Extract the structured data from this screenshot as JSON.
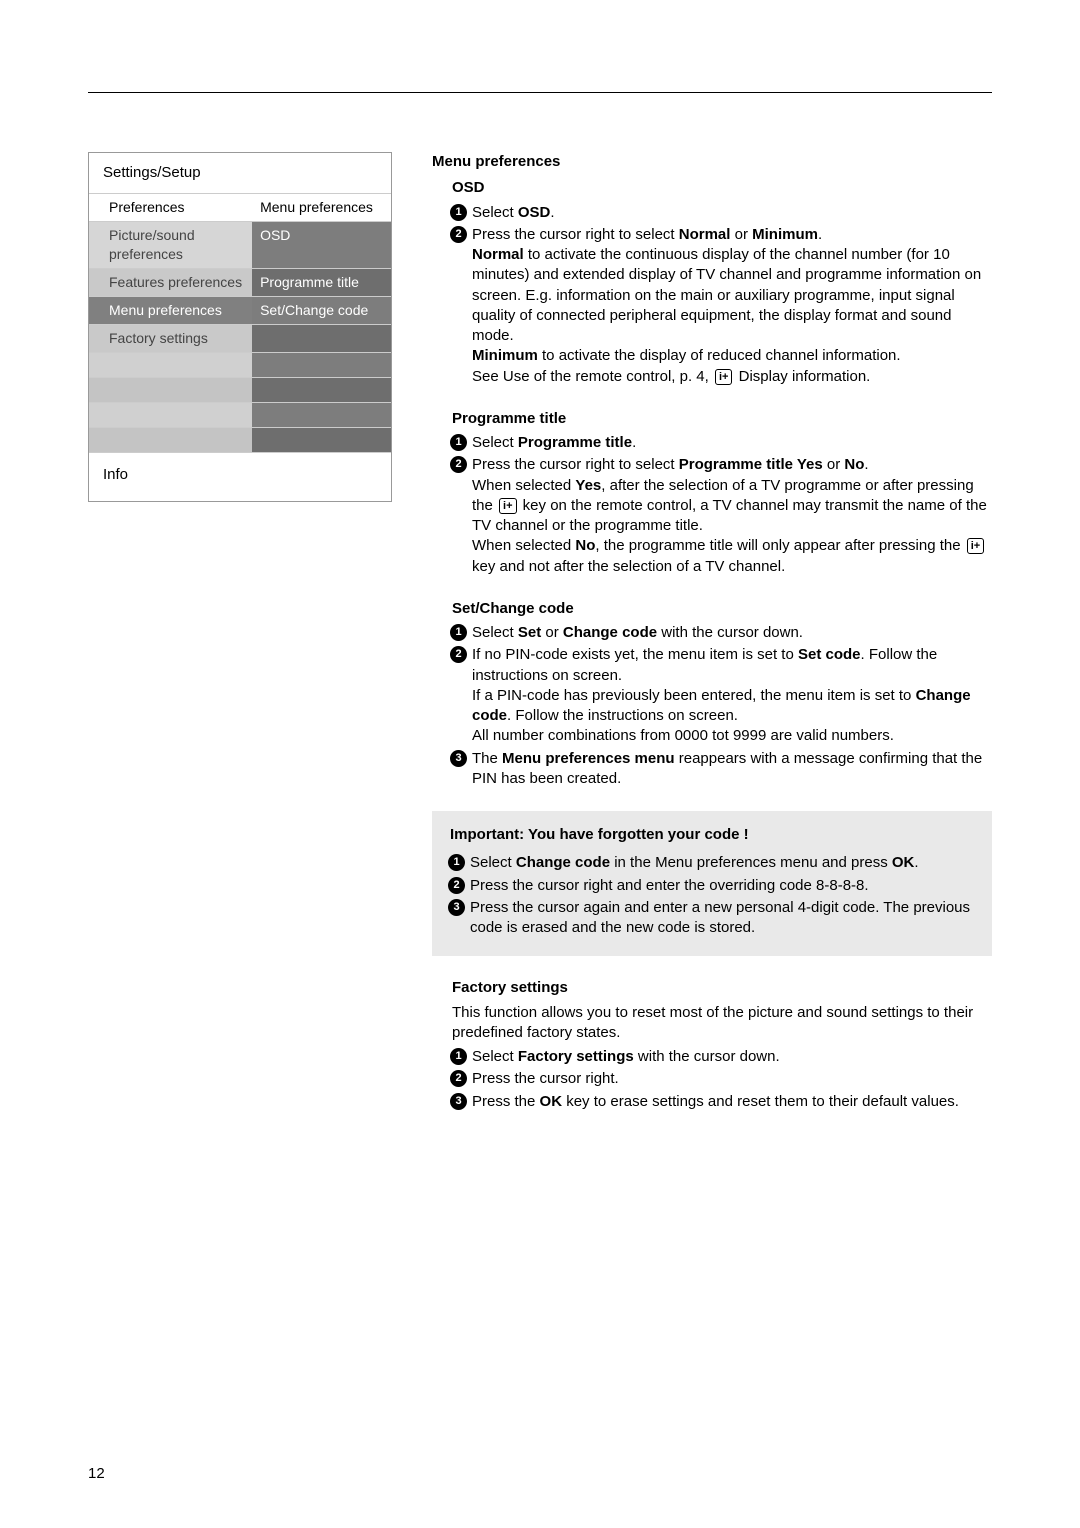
{
  "page_number": "12",
  "menu": {
    "box_title": "Settings/Setup",
    "col_left_header": "Preferences",
    "col_right_header": "Menu preferences",
    "rows": [
      {
        "l": "Picture/sound preferences",
        "r": "OSD"
      },
      {
        "l": "Features preferences",
        "r": "Programme title"
      },
      {
        "l": "Menu preferences",
        "r": "Set/Change code",
        "selected": true
      },
      {
        "l": "Factory settings",
        "r": ""
      }
    ],
    "footer": "Info"
  },
  "right": {
    "title": "Menu preferences",
    "osd": {
      "heading": "OSD",
      "step1_pre": "Select ",
      "step1_bold": "OSD",
      "step1_post": ".",
      "step2_pre": "Press the cursor right to select ",
      "step2_b1": "Normal",
      "step2_mid": " or ",
      "step2_b2": "Minimum",
      "step2_post": ".",
      "para1_b": "Normal",
      "para1": " to activate the continuous display of the channel number (for 10 minutes) and extended display of TV channel and programme information on screen. E.g. information on the main or auxiliary programme, input signal quality of connected peripheral equipment, the display format and sound mode.",
      "para2_b": "Minimum",
      "para2": " to activate the display of reduced channel information.",
      "para3_pre": "See Use of the remote control, p. 4, ",
      "para3_post": " Display information.",
      "info_icon": "i+"
    },
    "prog": {
      "heading": "Programme title",
      "step1_pre": "Select ",
      "step1_bold": "Programme title",
      "step1_post": ".",
      "step2_pre": "Press the cursor right to select ",
      "step2_bold": "Programme title Yes",
      "step2_mid": " or ",
      "step2_bold2": "No",
      "step2_post": ".",
      "para1_pre": "When selected ",
      "para1_b": "Yes",
      "para1_mid": ", after the selection of a TV programme or after pressing the ",
      "para1_post": " key on the remote control, a TV channel may transmit the name of the TV channel or the programme title.",
      "para2_pre": "When selected ",
      "para2_b": "No",
      "para2_mid": ", the programme title will only appear after pressing the ",
      "para2_post": " key and not after the selection of a TV channel.",
      "info_icon": "i+"
    },
    "setcode": {
      "heading": "Set/Change code",
      "step1_pre": "Select ",
      "step1_b1": "Set",
      "step1_mid": " or ",
      "step1_b2": "Change code",
      "step1_post": " with the cursor down.",
      "step2_pre": "If no PIN-code exists yet, the menu item is set to ",
      "step2_b": "Set code",
      "step2_post": ". Follow the instructions on screen.",
      "step2b_pre": "If a PIN-code has previously been entered, the menu item is set to ",
      "step2b_b": "Change code",
      "step2b_post": ". Follow the instructions on screen.",
      "step2c": "All number combinations from 0000 tot 9999 are valid numbers.",
      "step3_pre": "The ",
      "step3_b": "Menu preferences menu",
      "step3_post": " reappears with a message confirming that the PIN has been created."
    },
    "note": {
      "heading": "Important: You have forgotten your code !",
      "step1_pre": "Select ",
      "step1_b": "Change code",
      "step1_mid": " in the Menu preferences menu and press ",
      "step1_b2": "OK",
      "step1_post": ".",
      "step2": "Press the cursor right and enter the overriding code 8-8-8-8.",
      "step3": "Press the cursor again and enter a new personal 4-digit code. The previous code is erased and the new code is stored."
    },
    "factory": {
      "heading": "Factory settings",
      "intro": "This function allows you to reset most of the picture and sound settings to their predefined factory states.",
      "step1_pre": "Select ",
      "step1_b": "Factory settings",
      "step1_post": " with the cursor down.",
      "step2": "Press the cursor right.",
      "step3_pre": "Press the ",
      "step3_b": "OK",
      "step3_post": " key to erase settings and reset them to their default values."
    }
  }
}
